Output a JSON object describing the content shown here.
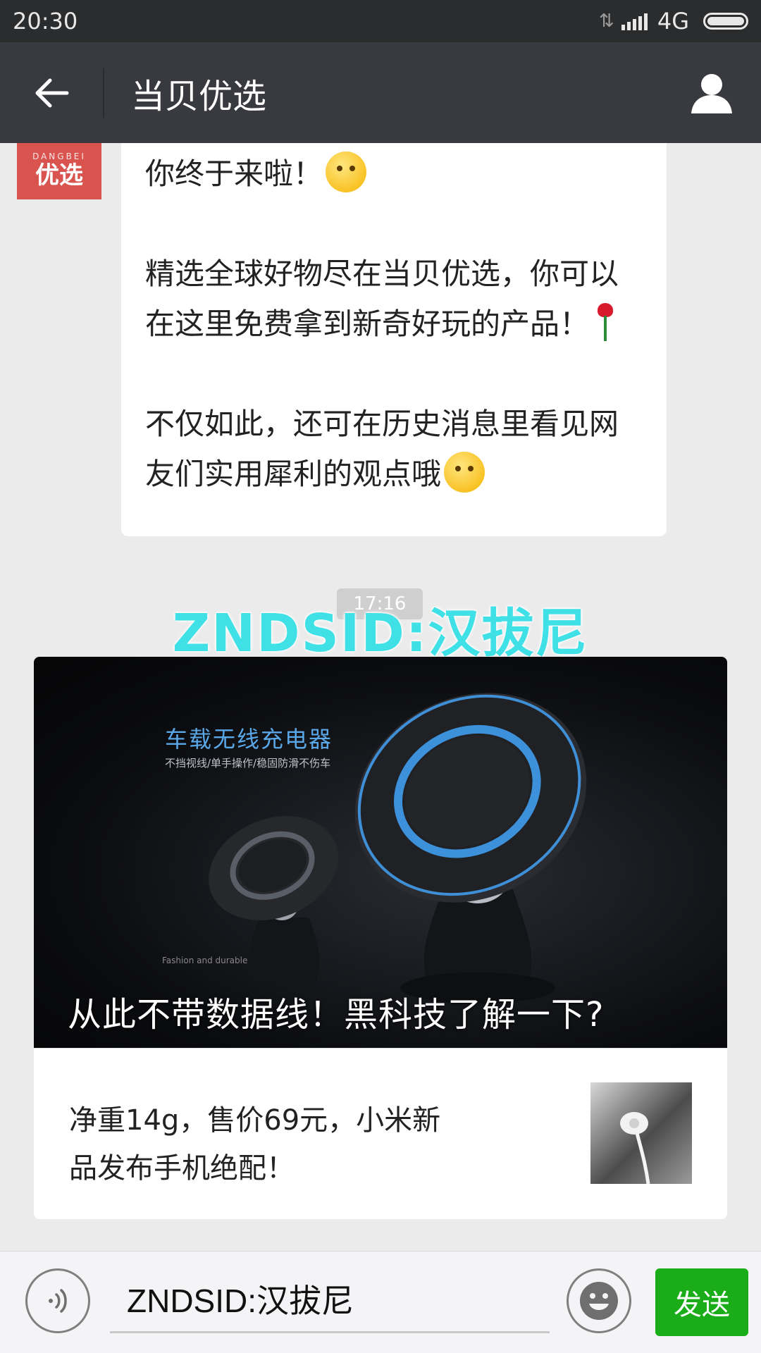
{
  "status_bar": {
    "time": "20:30",
    "network": "4G"
  },
  "nav": {
    "title": "当贝优选",
    "back_icon": "arrow-left-icon",
    "profile_icon": "person-icon"
  },
  "sender": {
    "avatar_sub": "DANGBEI",
    "avatar_main": "优选"
  },
  "message": {
    "line1": "你终于来啦！",
    "line2": "精选全球好物尽在当贝优选，你可以在这里免费拿到新奇好玩的产品！",
    "line3": "不仅如此，还可在历史消息里看见网友们实用犀利的观点哦"
  },
  "timestamp": "17:16",
  "watermark": "ZNDSID:汉拔尼",
  "article": {
    "cover_headline": "车载无线充电器",
    "cover_tagline": "不挡视线/单手操作/稳固防滑不伤车",
    "cover_small": "Fashion and durable",
    "cover_title": "从此不带数据线！黑科技了解一下?",
    "second_title": "净重14g，售价69元，小米新品发布手机绝配！"
  },
  "input_bar": {
    "value": "ZNDSID:汉拔尼",
    "send_label": "发送",
    "voice_icon": "voice-icon",
    "emoji_icon": "smiley-icon"
  },
  "colors": {
    "status_bar": "#2b2c2e",
    "nav_bar": "#393a3f",
    "chat_bg": "#ebebeb",
    "send_green": "#1aad19",
    "avatar_red": "#d9534f",
    "watermark_cyan": "#3fe0e6"
  }
}
